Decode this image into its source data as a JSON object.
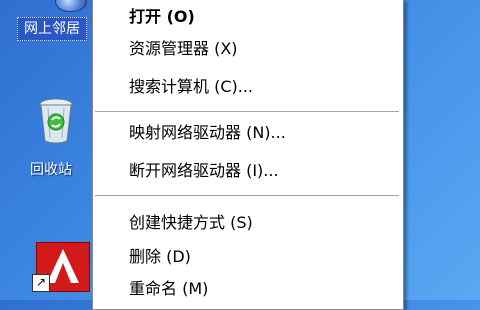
{
  "desktop": {
    "network_icon": {
      "label": "网上邻居",
      "icon": "network-neighborhood-icon"
    },
    "recycle_bin": {
      "label": "回收站",
      "icon": "recycle-bin-icon"
    },
    "app_shortcut": {
      "icon": "app-shortcut-icon"
    }
  },
  "context_menu": {
    "groups": [
      [
        {
          "label": "打开 (O)",
          "bold": true
        },
        {
          "label": "资源管理器 (X)"
        },
        {
          "label": "搜索计算机 (C)..."
        }
      ],
      [
        {
          "label": "映射网络驱动器 (N)..."
        },
        {
          "label": "断开网络驱动器 (I)..."
        }
      ],
      [
        {
          "label": "创建快捷方式 (S)"
        },
        {
          "label": "删除 (D)"
        },
        {
          "label": "重命名 (M)"
        }
      ]
    ]
  },
  "colors": {
    "desktop_bg": "#3a84e0",
    "selection": "#2a56c6",
    "menu_bg": "#ffffff",
    "separator": "#a6a6a6"
  }
}
